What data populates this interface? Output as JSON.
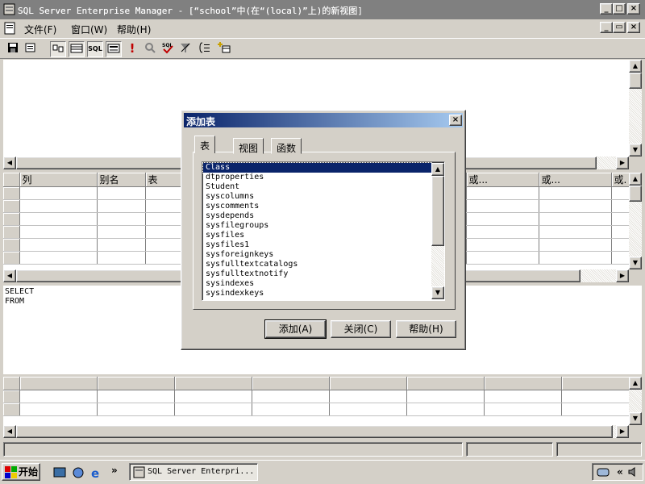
{
  "window": {
    "title": "SQL Server Enterprise Manager - [“school”中(在“(local)”上)的新视图]",
    "outer_buttons": [
      "_",
      "□",
      "×"
    ],
    "inner_buttons": [
      "_",
      "▭",
      "×"
    ]
  },
  "menu": {
    "items": [
      "文件(F)",
      "窗口(W)",
      "帮助(H)"
    ]
  },
  "toolbar": {
    "icons": [
      "save-icon",
      "properties-icon",
      "diagram-pane-icon",
      "grid-pane-icon",
      "sql-pane-icon",
      "results-pane-icon",
      "run-icon",
      "verify-icon",
      "check-sql-icon",
      "remove-filter-icon",
      "group-by-icon",
      "add-table-icon"
    ],
    "sql_label": "SQL"
  },
  "grid": {
    "columns": [
      "列",
      "别名",
      "表"
    ],
    "right_columns": [
      "或...",
      "或...",
      "或."
    ]
  },
  "sql_pane": {
    "lines": [
      "SELECT",
      "FROM"
    ]
  },
  "dialog": {
    "title": "添加表",
    "close": "×",
    "tabs": [
      "表",
      "视图",
      "函数"
    ],
    "items": [
      "Class",
      "dtproperties",
      "Student",
      "syscolumns",
      "syscomments",
      "sysdepends",
      "sysfilegroups",
      "sysfiles",
      "sysfiles1",
      "sysforeignkeys",
      "sysfulltextcatalogs",
      "sysfulltextnotify",
      "sysindexes",
      "sysindexkeys"
    ],
    "selected_index": 0,
    "buttons": {
      "add": "添加(A)",
      "close": "关闭(C)",
      "help": "帮助(H)"
    }
  },
  "taskbar": {
    "start": "开始",
    "chevron": "»",
    "task": "SQL Server Enterpri...",
    "tray_chevron": "«"
  }
}
